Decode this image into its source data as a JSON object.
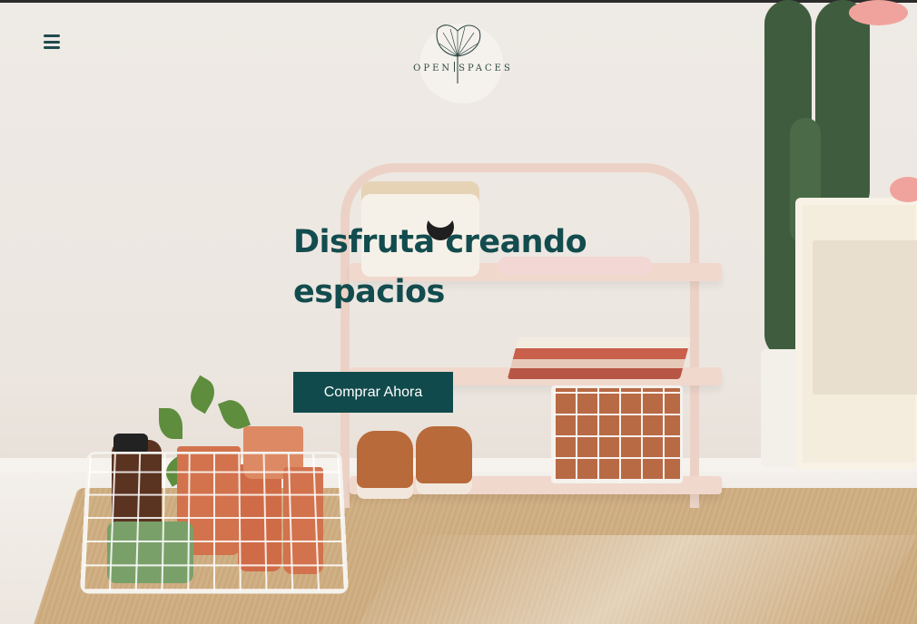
{
  "header": {
    "menu_icon": "hamburger-menu-icon",
    "logo": {
      "left_word": "OPEN",
      "right_word": "SPACES",
      "icon": "ginkgo-leaf-icon"
    }
  },
  "hero": {
    "headline_line1": "Disfruta creando",
    "headline_line2": "espacios",
    "cta_label": "Comprar Ahora"
  },
  "colors": {
    "accent": "#114a4c",
    "headline": "#134c4e",
    "background": "#eeeae5",
    "button_text": "#ffffff"
  }
}
